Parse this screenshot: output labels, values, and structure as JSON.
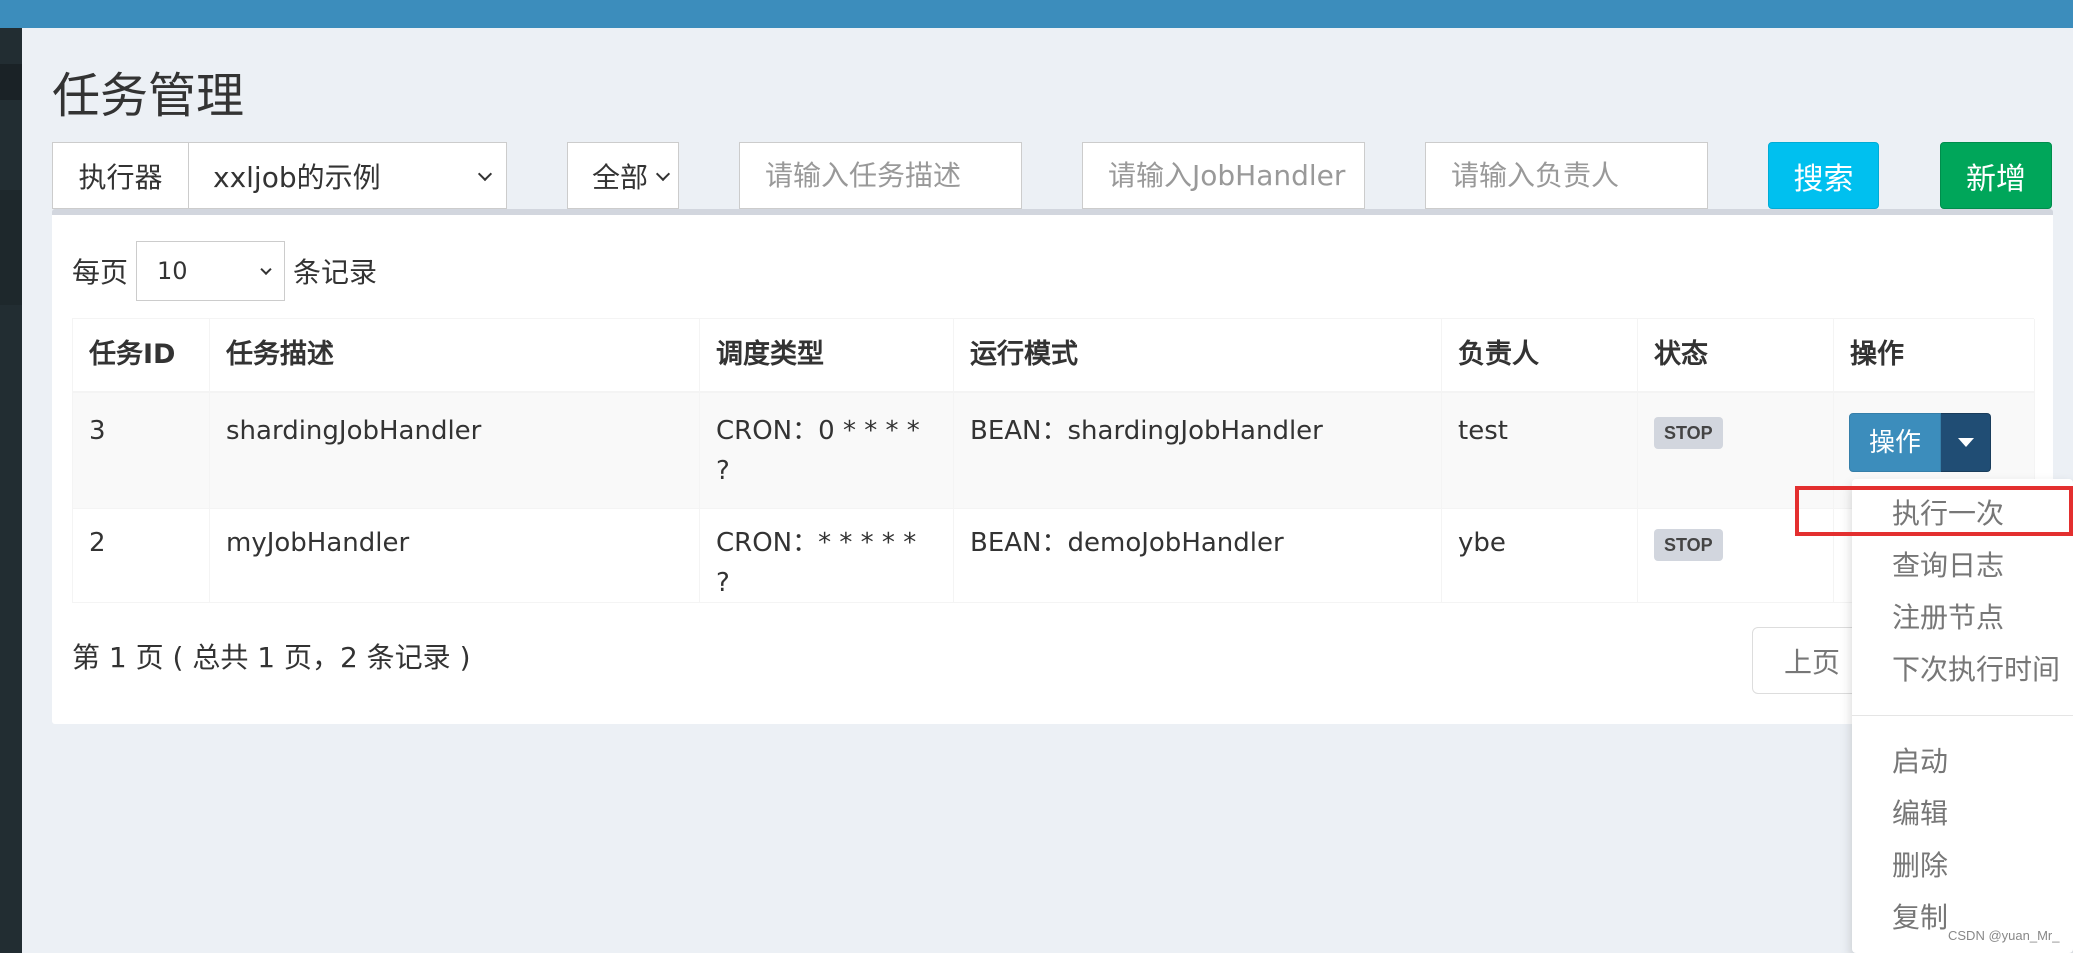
{
  "page": {
    "title": "任务管理"
  },
  "filters": {
    "executor_label": "执行器",
    "executor_value": "xxljob的示例",
    "status_value": "全部",
    "desc_placeholder": "请输入任务描述",
    "handler_placeholder": "请输入JobHandler",
    "author_placeholder": "请输入负责人",
    "search_label": "搜索",
    "add_label": "新增"
  },
  "length": {
    "prefix": "每页",
    "value": "10",
    "suffix": "条记录"
  },
  "table": {
    "headers": [
      "任务ID",
      "任务描述",
      "调度类型",
      "运行模式",
      "负责人",
      "状态",
      "操作"
    ],
    "rows": [
      {
        "id": "3",
        "desc": "shardingJobHandler",
        "schedule": "CRON：0 * * * * ?",
        "mode": "BEAN：shardingJobHandler",
        "author": "test",
        "status": "STOP",
        "action": "操作"
      },
      {
        "id": "2",
        "desc": "myJobHandler",
        "schedule": "CRON：* * * * * ?",
        "mode": "BEAN：demoJobHandler",
        "author": "ybe",
        "status": "STOP"
      }
    ]
  },
  "pagination": {
    "info": "第 1 页 ( 总共 1 页，2 条记录 )",
    "prev_label": "上页"
  },
  "dropdown": {
    "items": [
      "执行一次",
      "查询日志",
      "注册节点",
      "下次执行时间",
      "启动",
      "编辑",
      "删除",
      "复制"
    ]
  },
  "watermark": "CSDN @yuan_Mr_",
  "colors": {
    "primary": "#3c8dbc",
    "info": "#00c0ef",
    "success": "#00a65a",
    "highlight": "#e32f2f"
  }
}
